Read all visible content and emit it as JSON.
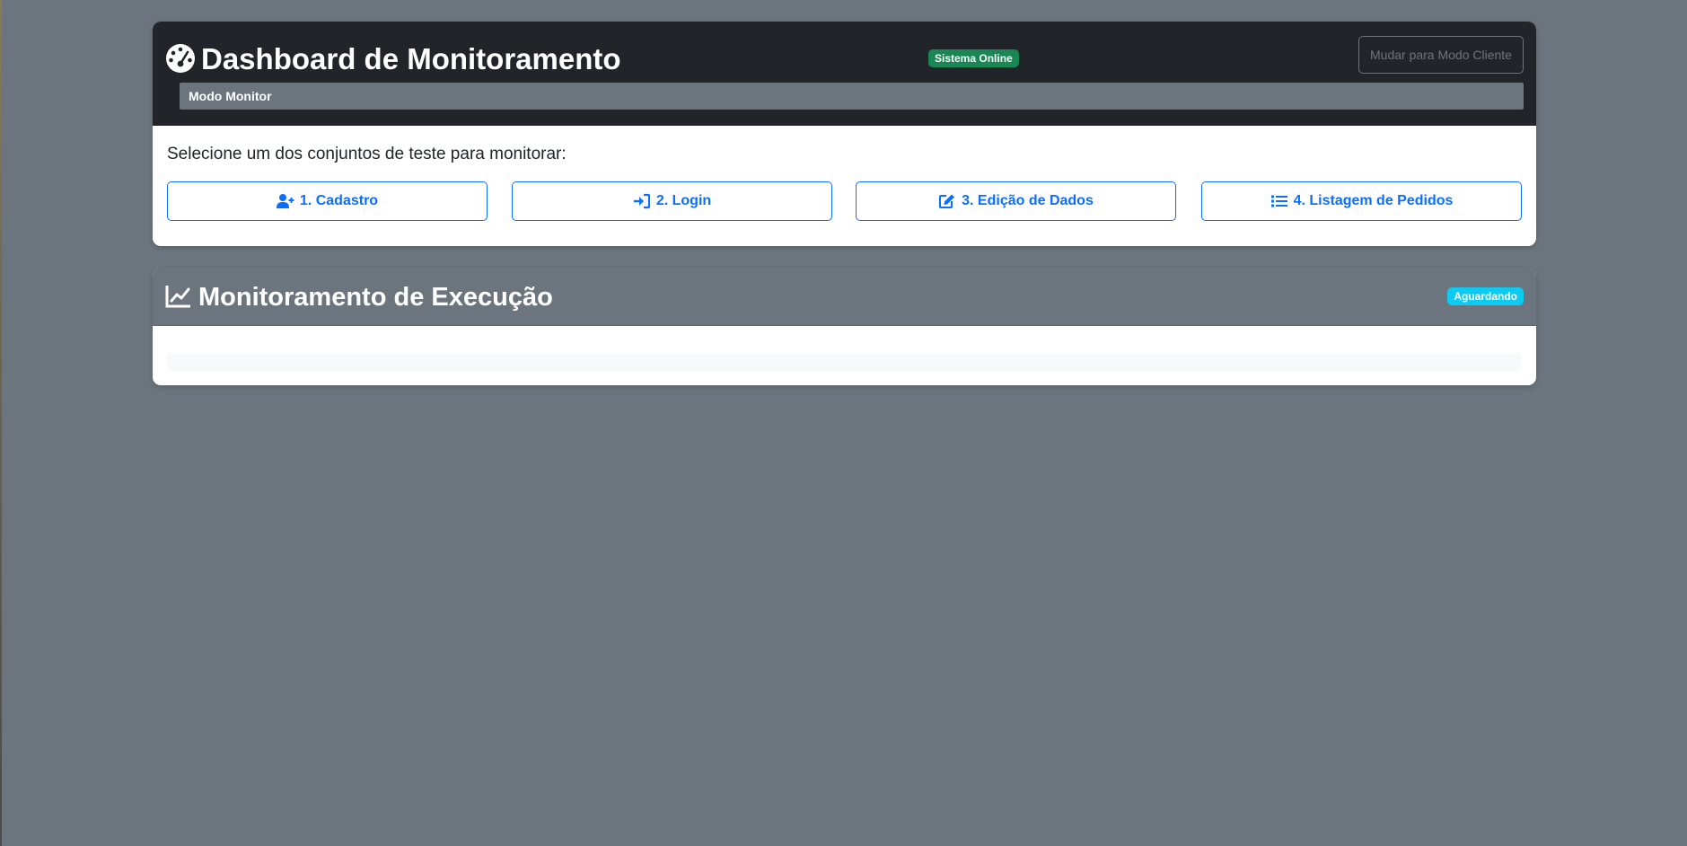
{
  "header": {
    "title": "Dashboard de Monitoramento",
    "status_badge": "Sistema Online",
    "switch_button": "Mudar para Modo Cliente",
    "mode_label": "Modo Monitor"
  },
  "tests": {
    "prompt": "Selecione um dos conjuntos de teste para monitorar:",
    "buttons": [
      {
        "label": "1. Cadastro",
        "icon": "user-plus-icon"
      },
      {
        "label": "2. Login",
        "icon": "sign-in-icon"
      },
      {
        "label": "3. Edição de Dados",
        "icon": "edit-icon"
      },
      {
        "label": "4. Listagem de Pedidos",
        "icon": "list-icon"
      }
    ]
  },
  "execution": {
    "title": "Monitoramento de Execução",
    "status_badge": "Aguardando"
  },
  "colors": {
    "primary": "#0d6efd",
    "success": "#198754",
    "info": "#0dcaf0",
    "dark": "#212529",
    "secondary": "#6c757d"
  }
}
